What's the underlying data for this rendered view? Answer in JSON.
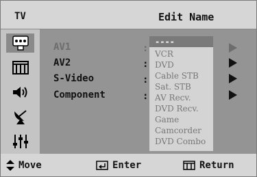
{
  "header": {
    "source_label": "TV",
    "title": "Edit Name"
  },
  "sidebar": {
    "items": [
      {
        "icon": "input-icon",
        "active": true
      },
      {
        "icon": "picture-icon",
        "active": false
      },
      {
        "icon": "sound-icon",
        "active": false
      },
      {
        "icon": "channel-icon",
        "active": false
      },
      {
        "icon": "setup-icon",
        "active": false
      }
    ]
  },
  "rows": [
    {
      "label": "AV1",
      "colon": ":",
      "disabled": true
    },
    {
      "label": "AV2",
      "colon": ":",
      "disabled": false
    },
    {
      "label": "S-Video",
      "colon": ":",
      "disabled": false
    },
    {
      "label": "Component",
      "colon": ":",
      "disabled": false
    }
  ],
  "dropdown": {
    "selected": "----",
    "options": [
      "----",
      "VCR",
      "DVD",
      "Cable STB",
      "Sat. STB",
      "AV Recv.",
      "DVD Recv.",
      "Game",
      "Camcorder",
      "DVD Combo"
    ]
  },
  "footer": {
    "move_label": "Move",
    "enter_label": "Enter",
    "return_label": "Return"
  }
}
